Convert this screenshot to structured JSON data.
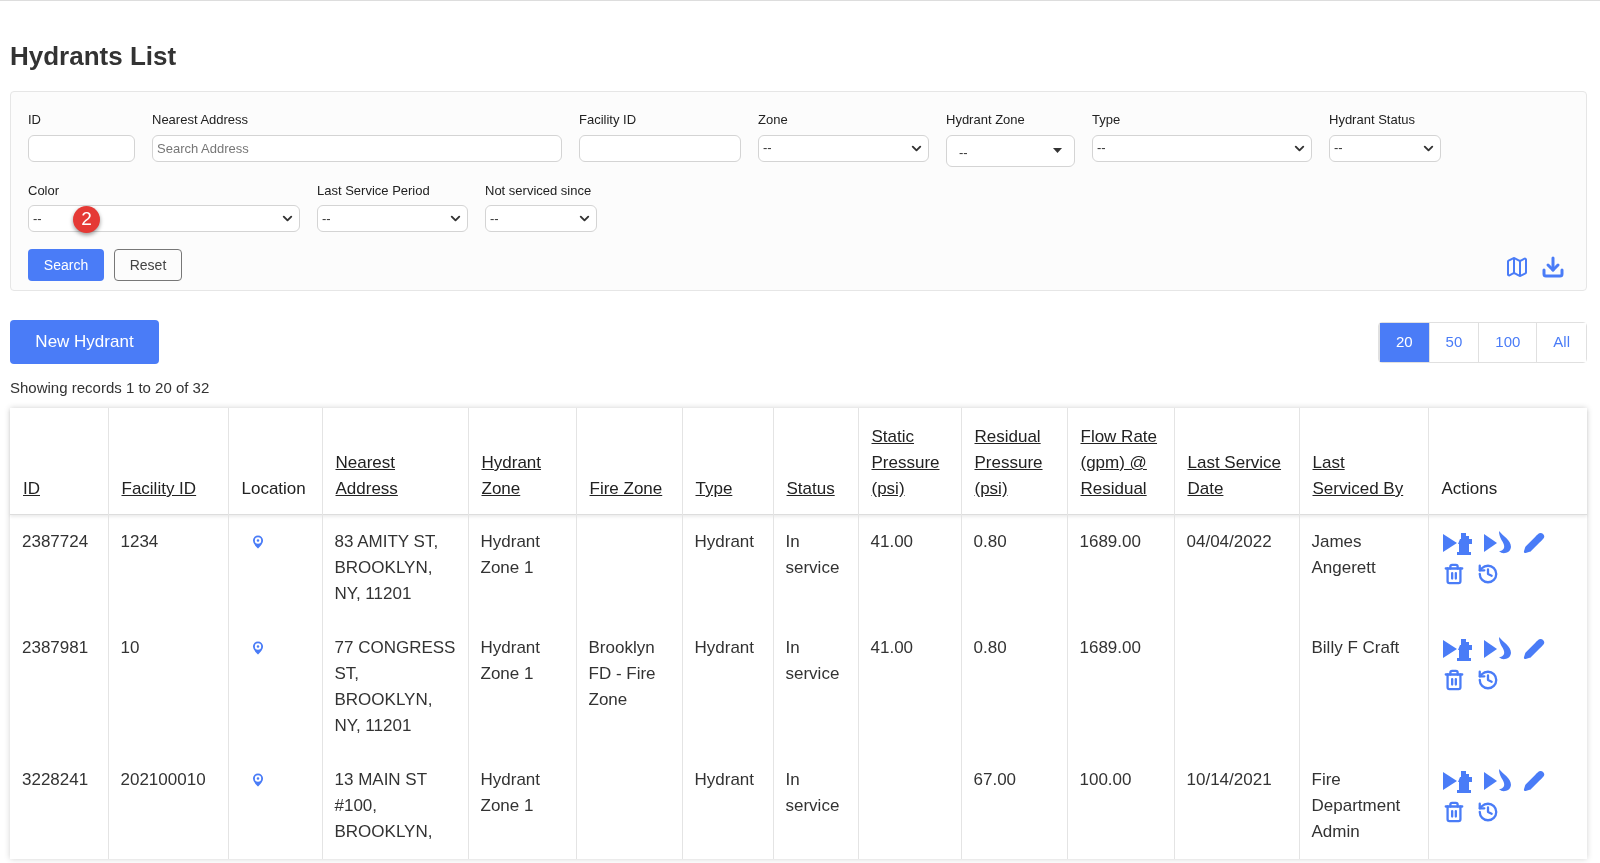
{
  "title": "Hydrants List",
  "filters": {
    "row1": [
      {
        "kind": "text",
        "label": "ID"
      },
      {
        "kind": "text",
        "label": "Nearest Address",
        "placeholder": "Search Address"
      },
      {
        "kind": "text",
        "label": "Facility ID"
      },
      {
        "kind": "select",
        "label": "Zone",
        "value": "--"
      },
      {
        "kind": "caret",
        "label": "Hydrant Zone",
        "value": "--"
      },
      {
        "kind": "select",
        "label": "Type",
        "value": "--"
      },
      {
        "kind": "select",
        "label": "Hydrant Status",
        "value": "--"
      }
    ],
    "row2": [
      {
        "kind": "select",
        "label": "Color",
        "value": "--",
        "badge": "2"
      },
      {
        "kind": "select",
        "label": "Last Service Period",
        "value": "--"
      },
      {
        "kind": "select",
        "label": "Not serviced since",
        "value": "--"
      }
    ],
    "search_button": "Search",
    "reset_button": "Reset"
  },
  "new_button": "New Hydrant",
  "page_sizes": [
    {
      "label": "20",
      "selected": true
    },
    {
      "label": "50",
      "selected": false
    },
    {
      "label": "100",
      "selected": false
    },
    {
      "label": "All",
      "selected": false
    }
  ],
  "records_info": "Showing records 1 to 20 of 32",
  "table": {
    "columns": [
      {
        "label": "ID",
        "sortable": true
      },
      {
        "label": "Facility ID",
        "sortable": true
      },
      {
        "label": "Location",
        "sortable": false
      },
      {
        "label": "Nearest Address",
        "sortable": true
      },
      {
        "label": "Hydrant Zone",
        "sortable": true
      },
      {
        "label": "Fire Zone",
        "sortable": true
      },
      {
        "label": "Type",
        "sortable": true
      },
      {
        "label": "Status",
        "sortable": true
      },
      {
        "label": "Static Pressure (psi)",
        "sortable": true
      },
      {
        "label": "Residual Pressure (psi)",
        "sortable": true
      },
      {
        "label": "Flow Rate (gpm) @ Residual",
        "sortable": true
      },
      {
        "label": "Last Service Date",
        "sortable": true
      },
      {
        "label": "Last Serviced By",
        "sortable": true
      },
      {
        "label": "Actions",
        "sortable": false
      }
    ],
    "rows": [
      {
        "id": "2387724",
        "facility_id": "1234",
        "has_location": true,
        "address": "83 AMITY ST, BROOKLYN, NY, 11201",
        "hydrant_zone": "Hydrant Zone 1",
        "fire_zone": "",
        "type": "Hydrant",
        "status": "In service",
        "static": "41.00",
        "residual": "0.80",
        "flow": "1689.00",
        "last_date": "04/04/2022",
        "last_by": "James Angerett"
      },
      {
        "id": "2387981",
        "facility_id": "10",
        "has_location": true,
        "address": "77 CONGRESS ST, BROOKLYN, NY, 11201",
        "hydrant_zone": "Hydrant Zone 1",
        "fire_zone": "Brooklyn FD - Fire Zone",
        "type": "Hydrant",
        "status": "In service",
        "static": "41.00",
        "residual": "0.80",
        "flow": "1689.00",
        "last_date": "",
        "last_by": "Billy F Craft"
      },
      {
        "id": "3228241",
        "facility_id": "202100010",
        "has_location": true,
        "address": "13 MAIN ST #100, BROOKLYN,",
        "hydrant_zone": "Hydrant Zone 1",
        "fire_zone": "",
        "type": "Hydrant",
        "status": "In service",
        "static": "",
        "residual": "67.00",
        "flow": "100.00",
        "last_date": "10/14/2021",
        "last_by": "Fire Department Admin"
      }
    ]
  }
}
